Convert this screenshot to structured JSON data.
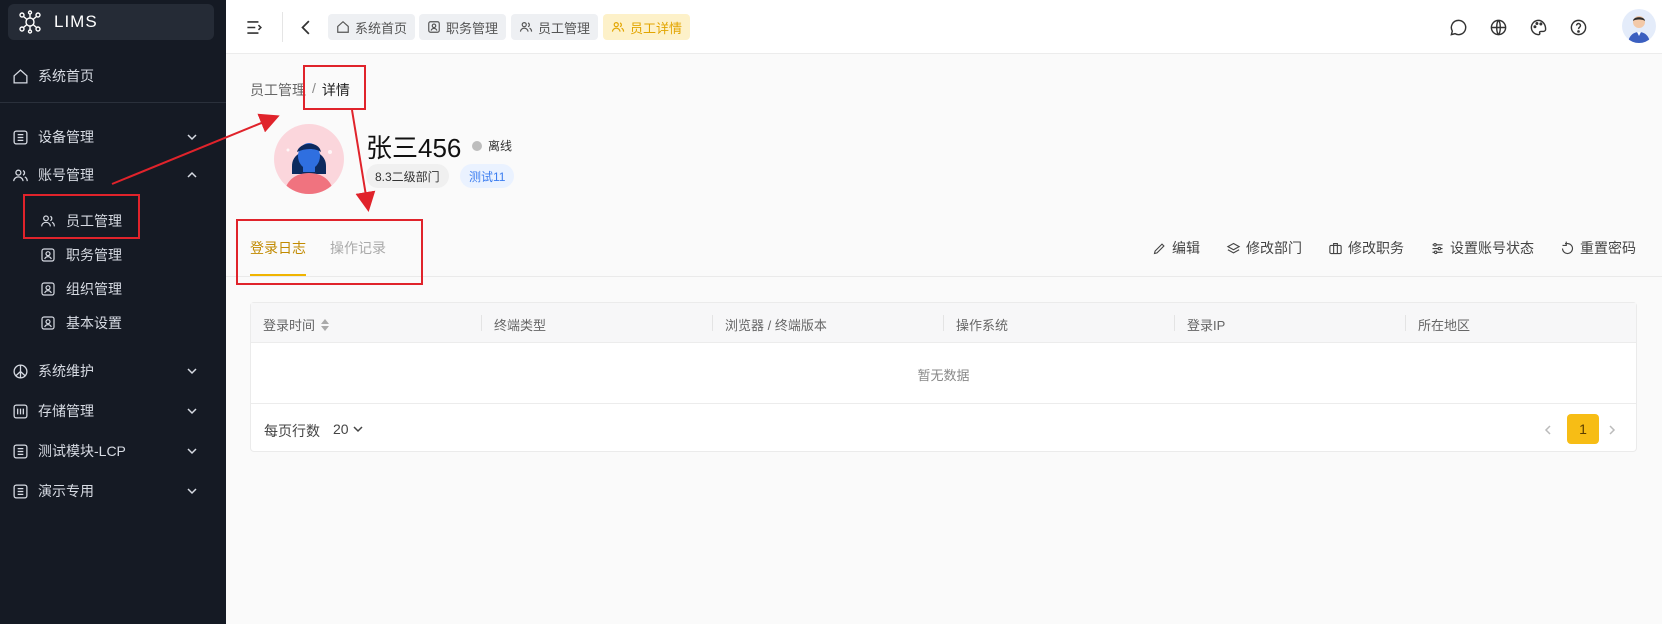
{
  "app": {
    "name": "LIMS"
  },
  "sidebar": {
    "items": [
      {
        "label": "系统首页"
      },
      {
        "label": "设备管理"
      },
      {
        "label": "账号管理"
      },
      {
        "label": "系统维护"
      },
      {
        "label": "存储管理"
      },
      {
        "label": "测试模块-LCP"
      },
      {
        "label": "演示专用"
      }
    ],
    "account_sub": [
      {
        "label": "员工管理"
      },
      {
        "label": "职务管理"
      },
      {
        "label": "组织管理"
      },
      {
        "label": "基本设置"
      }
    ]
  },
  "topbar": {
    "tabs": [
      {
        "label": "系统首页",
        "icon": "home-icon"
      },
      {
        "label": "职务管理",
        "icon": "id-badge-icon"
      },
      {
        "label": "员工管理",
        "icon": "users-icon"
      },
      {
        "label": "员工详情",
        "icon": "users-icon",
        "active": true
      }
    ],
    "right_icons": [
      "message-icon",
      "globe-icon",
      "palette-icon",
      "help-icon",
      "avatar"
    ]
  },
  "breadcrumb": {
    "parent": "员工管理",
    "separator": "/",
    "current": "详情"
  },
  "profile": {
    "name": "张三456",
    "status": "离线",
    "department": "8.3二级部门",
    "role": "测试11"
  },
  "tabs": [
    {
      "label": "登录日志",
      "active": true
    },
    {
      "label": "操作记录",
      "active": false
    }
  ],
  "actions": [
    {
      "label": "编辑",
      "icon": "pencil-icon"
    },
    {
      "label": "修改部门",
      "icon": "layers-icon"
    },
    {
      "label": "修改职务",
      "icon": "briefcase-icon"
    },
    {
      "label": "设置账号状态",
      "icon": "sliders-icon"
    },
    {
      "label": "重置密码",
      "icon": "reset-icon"
    }
  ],
  "table": {
    "columns": [
      "登录时间",
      "终端类型",
      "浏览器 / 终端版本",
      "操作系统",
      "登录IP",
      "所在地区"
    ],
    "empty_text": "暂无数据",
    "rows_per_page_label": "每页行数",
    "rows_per_page": "20",
    "current_page": "1"
  },
  "colors": {
    "accent": "#f7bd15",
    "sidebar_bg": "#151a24",
    "annotation": "#e0232b"
  }
}
